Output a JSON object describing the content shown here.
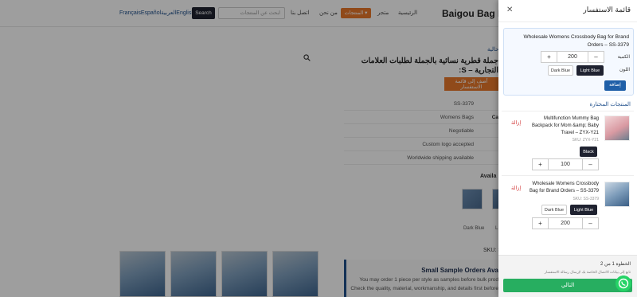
{
  "header": {
    "languages": "FrançaisEspañolالعربيةEnglish",
    "search_button": "Search",
    "search_placeholder": "ابحث عن المنتجات",
    "nav": [
      "اتصل بنا",
      "من نحن",
      "المنتجات",
      "متجر",
      "الرئيسية"
    ],
    "brand": "Baigou Bag Fa"
  },
  "product": {
    "breadcrumb": "حالية",
    "title": "جملة قطرية نسائية بالجملة لطلبات العلامات التجارية – S:",
    "inquiry_button": "أضف إلى قائمة الاستفسار",
    "specs": [
      {
        "value": "SS-3379",
        "key": ""
      },
      {
        "value": "Womens Bags",
        "key": "Ca"
      },
      {
        "value": "Negotiable",
        "key": ""
      },
      {
        "value": "Custom logo accepted",
        "key": ""
      },
      {
        "value": "Worldwide shipping available",
        "key": ""
      }
    ],
    "available_label": "Availa",
    "variant_label": "Dark Blue",
    "variant_label_2": "L",
    "sku_label": "SKU: S",
    "sample_title": "Small Sample Orders Ava",
    "sample_lines": [
      "You may order 1 piece per style as samples before bulk prod",
      "Check the quality, material, workmanship, and details first before"
    ]
  },
  "drawer": {
    "title": "قائمة الاستفسار",
    "close_icon": "close-icon",
    "current": {
      "title": "Wholesale Womens Crossbody Bag for Brand Orders – SS-3379",
      "qty_label": "الكمية",
      "color_label": "اللون",
      "qty": "200",
      "colors": [
        "Light Blue",
        "Dark Blue"
      ],
      "selected_color": "Light Blue",
      "add_button": "إضافة"
    },
    "selected_title": "المنتجات المختارة",
    "items": [
      {
        "title": "Multifunction Mummy Bag Backpack for Mom &amp; Baby Travel – ZYX-Y21",
        "sku": "SKU: ZYX-Y21",
        "remove": "إزالة",
        "colors": [
          "Black"
        ],
        "selected_color": "Black",
        "qty": "100"
      },
      {
        "title": "Wholesale Womens Crossbody Bag for Brand Orders – SS-3379",
        "sku": "SKU: SS-3379",
        "remove": "إزالة",
        "colors": [
          "Light Blue",
          "Dark Blue"
        ],
        "selected_color": "Light Blue",
        "qty": "200"
      }
    ],
    "stepper_plus": "+",
    "stepper_minus": "–",
    "footer": {
      "step": "الخطوة 1 من 2",
      "hint": "تابع إلى بيانات الاتصال الخاصة بك لإرسال رسالة الاستفسار",
      "next_button": "التالي"
    }
  },
  "colors": {
    "accent_orange": "#e8782b",
    "dark": "#1f2230",
    "blue": "#1f5fa8",
    "green": "#27ae60",
    "whatsapp": "#25d366"
  }
}
